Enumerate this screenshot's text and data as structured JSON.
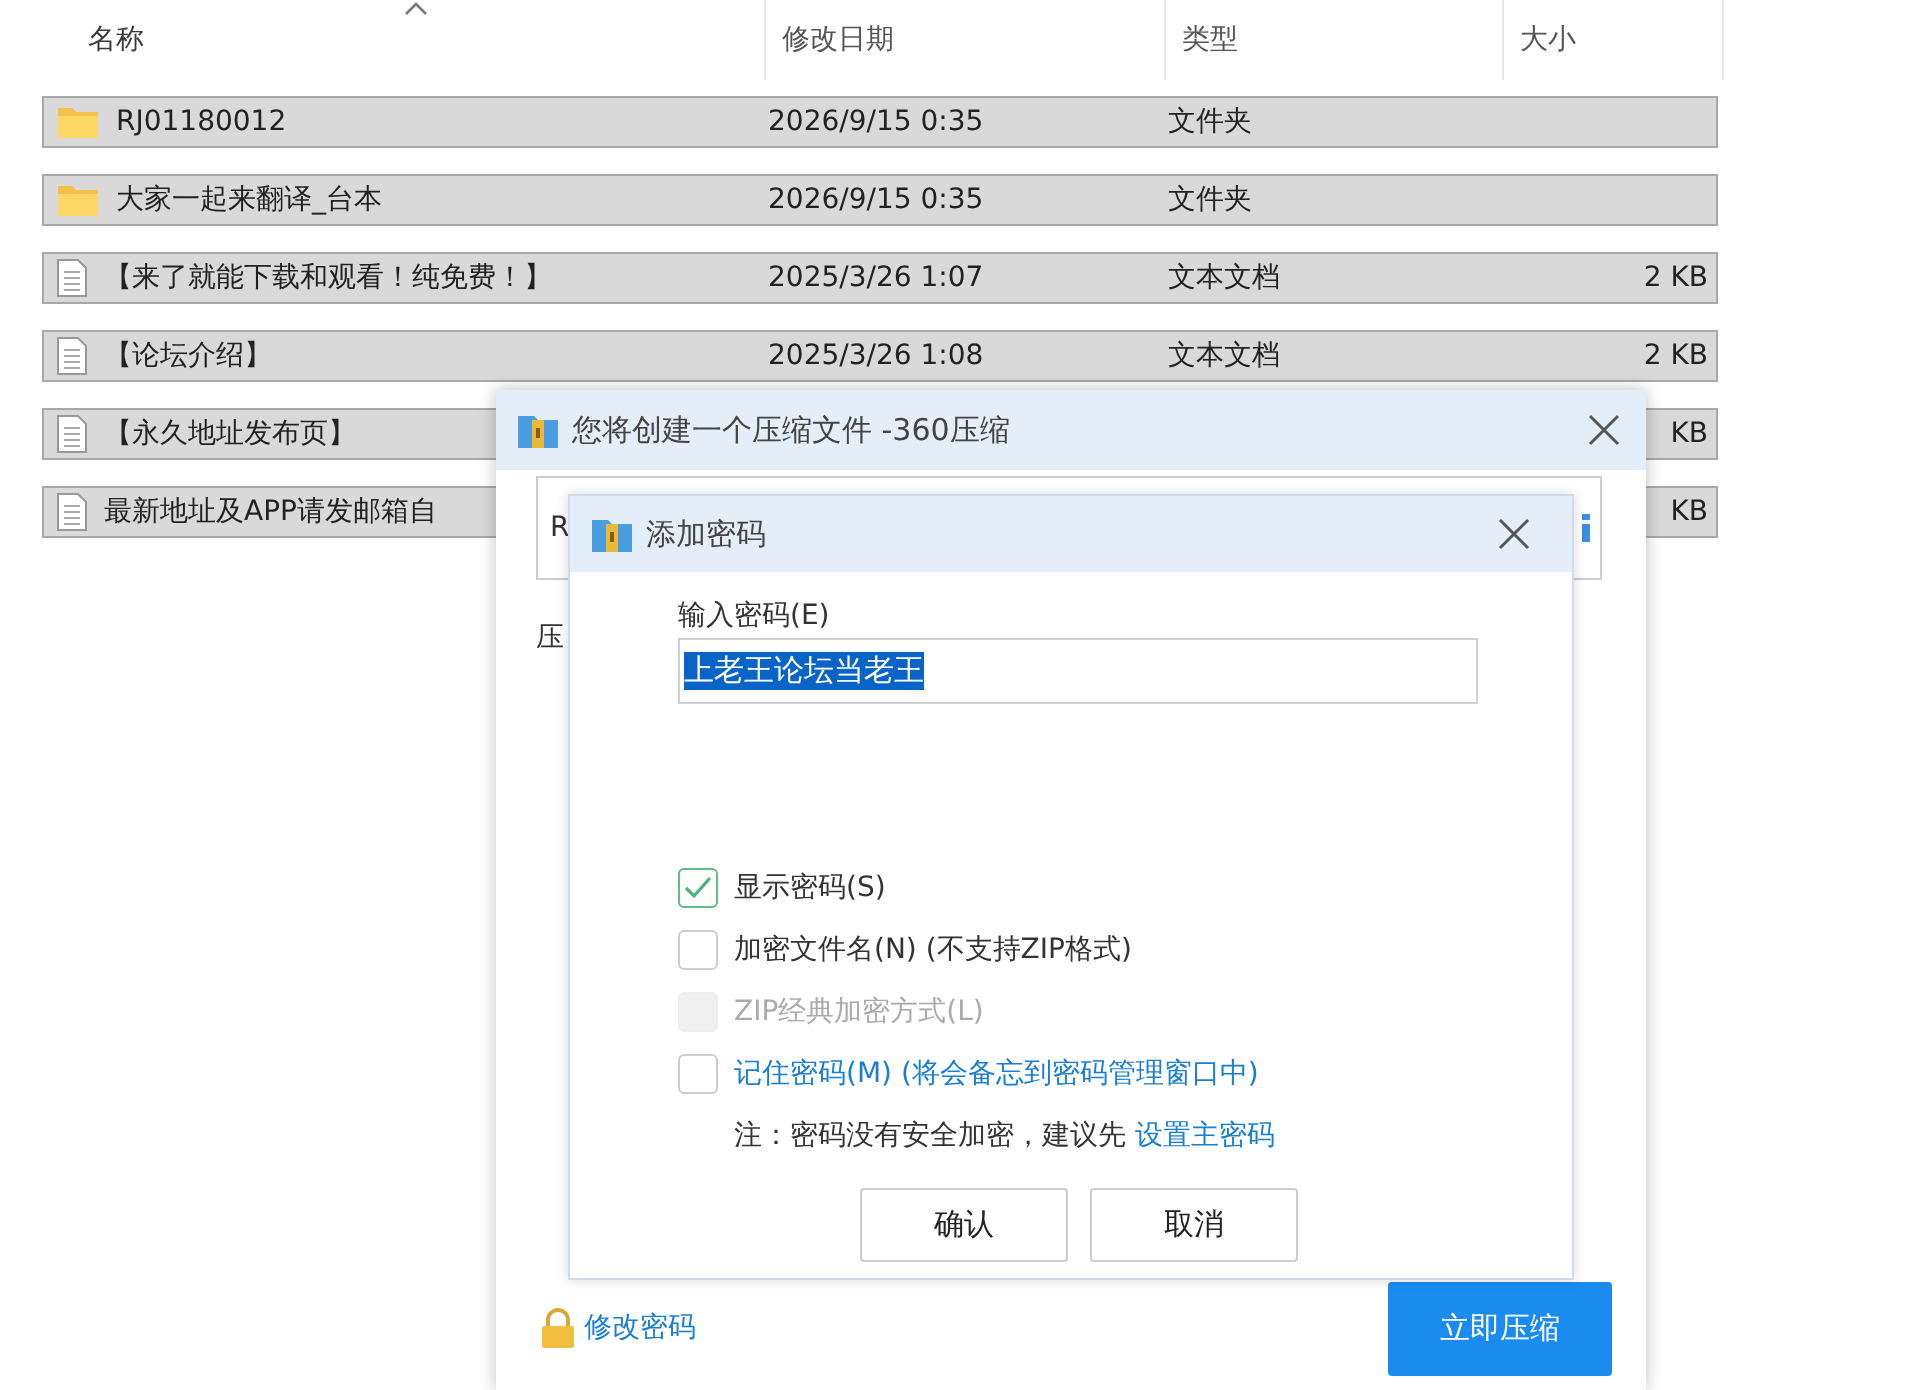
{
  "file_list": {
    "columns": [
      {
        "label": "名称",
        "sorted": true
      },
      {
        "label": "修改日期",
        "sorted": false
      },
      {
        "label": "类型",
        "sorted": false
      },
      {
        "label": "大小",
        "sorted": false
      }
    ],
    "rows": [
      {
        "kind": "folder",
        "name": "RJ01180012",
        "date": "2026/9/15 0:35",
        "type": "文件夹",
        "selected": true
      },
      {
        "kind": "folder",
        "name": "大家一起来翻译_台本",
        "date": "2026/9/15 0:35",
        "type": "文件夹",
        "selected": true
      },
      {
        "kind": "text",
        "name": "【来了就能下载和观看！纯免费！】",
        "date": "2025/3/26 1:07",
        "type": "文本文档",
        "size": "2 KB",
        "selected": true
      },
      {
        "kind": "text",
        "name": "【论坛介绍】",
        "date": "2025/3/26 1:08",
        "type": "文本文档",
        "size": "2 KB",
        "selected": true
      },
      {
        "kind": "text",
        "name": "【永久地址发布页】",
        "size": "KB",
        "selected": true
      },
      {
        "kind": "text",
        "name": "最新地址及APP请发邮箱自",
        "size": "KB",
        "selected": true
      }
    ]
  },
  "compress_dialog": {
    "title": "您将创建一个压缩文件 -360压缩",
    "field_value": "R",
    "label": "压",
    "change_password_link": "修改密码",
    "compress_button": "立即压缩"
  },
  "password_dialog": {
    "title": "添加密码",
    "password_label": "输入密码(E)",
    "password_value": "上老王论坛当老王",
    "options": [
      {
        "kind": "plain",
        "label": "显示密码(S)",
        "checked": true,
        "disabled": false
      },
      {
        "kind": "plain",
        "label": "加密文件名(N) (不支持ZIP格式)",
        "checked": false,
        "disabled": false
      },
      {
        "kind": "plain",
        "label": "ZIP经典加密方式(L)",
        "checked": false,
        "disabled": true
      },
      {
        "kind": "link",
        "label": "记住密码(M) (将会备忘到密码管理窗口中)",
        "checked": false,
        "disabled": false
      }
    ],
    "note": "注：密码没有安全加密，建议先",
    "note_link": "设置主密码",
    "buttons": [
      "确认",
      "取消"
    ]
  }
}
